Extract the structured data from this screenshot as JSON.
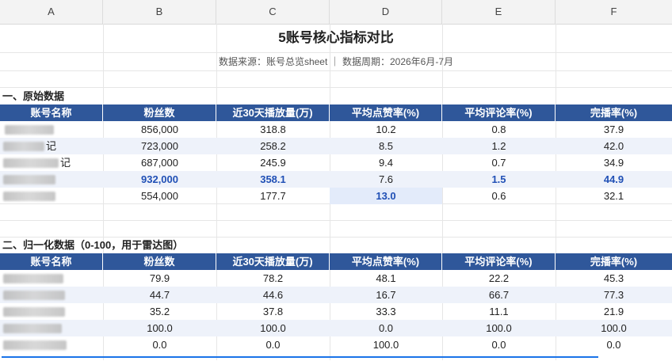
{
  "columns": [
    "A",
    "B",
    "C",
    "D",
    "E",
    "F"
  ],
  "title": "5账号核心指标对比",
  "subtitle": "数据来源：账号总览sheet ｜ 数据周期：2026年6月-7月",
  "section1": {
    "heading": "一、原始数据",
    "headers": [
      "账号名称",
      "粉丝数",
      "近30天播放量(万)",
      "平均点赞率(%)",
      "平均评论率(%)",
      "完播率(%)"
    ],
    "rows": [
      {
        "name_tail": "",
        "values": [
          "856,000",
          "318.8",
          "10.2",
          "0.8",
          "37.9"
        ],
        "highlight": []
      },
      {
        "name_tail": "记",
        "values": [
          "723,000",
          "258.2",
          "8.5",
          "1.2",
          "42.0"
        ],
        "highlight": []
      },
      {
        "name_tail": "记",
        "values": [
          "687,000",
          "245.9",
          "9.4",
          "0.7",
          "34.9"
        ],
        "highlight": []
      },
      {
        "name_tail": "",
        "values": [
          "932,000",
          "358.1",
          "7.6",
          "1.5",
          "44.9"
        ],
        "highlight": [
          0,
          1,
          3,
          4
        ]
      },
      {
        "name_tail": "",
        "values": [
          "554,000",
          "177.7",
          "13.0",
          "0.6",
          "32.1"
        ],
        "highlight": [
          2
        ]
      }
    ]
  },
  "section2": {
    "heading": "二、归一化数据（0-100，用于雷达图）",
    "headers": [
      "账号名称",
      "粉丝数",
      "近30天播放量(万)",
      "平均点赞率(%)",
      "平均评论率(%)",
      "完播率(%)"
    ],
    "rows": [
      {
        "values": [
          "79.9",
          "78.2",
          "48.1",
          "22.2",
          "45.3"
        ]
      },
      {
        "values": [
          "44.7",
          "44.6",
          "16.7",
          "66.7",
          "77.3"
        ]
      },
      {
        "values": [
          "35.2",
          "37.8",
          "33.3",
          "11.1",
          "21.9"
        ]
      },
      {
        "values": [
          "100.0",
          "100.0",
          "0.0",
          "100.0",
          "100.0"
        ]
      },
      {
        "values": [
          "0.0",
          "0.0",
          "100.0",
          "0.0",
          "0.0"
        ]
      }
    ]
  },
  "colors": {
    "header_bg": "#2f579a",
    "alt_row": "#eef2fa",
    "highlight_text": "#1f4fb5",
    "selection": "#1a73e8"
  }
}
